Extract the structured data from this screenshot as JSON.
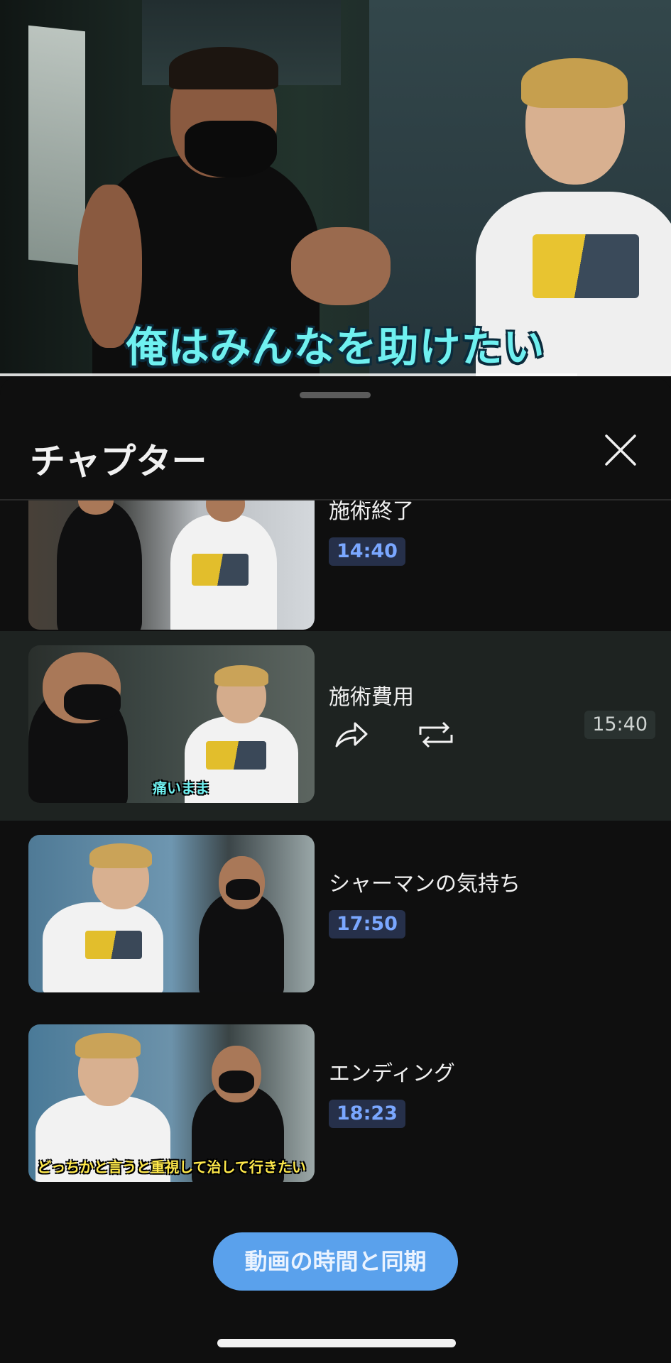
{
  "video": {
    "subtitle": "俺はみんなを助けたい",
    "progress": 0.86
  },
  "sheet": {
    "title": "チャプター",
    "close_icon": "close-icon"
  },
  "chapters": [
    {
      "title": "施術終了",
      "time": "14:40",
      "active": false,
      "thumb_caption": ""
    },
    {
      "title": "施術費用",
      "time": "15:40",
      "active": true,
      "thumb_caption": "痛いまま",
      "actions": [
        "share-icon",
        "repeat-icon"
      ]
    },
    {
      "title": "シャーマンの気持ち",
      "time": "17:50",
      "active": false,
      "thumb_caption": ""
    },
    {
      "title": "エンディング",
      "time": "18:23",
      "active": false,
      "thumb_caption": "どっちかと言うと重視して治して行きたい"
    }
  ],
  "sync_button": {
    "label": "動画の時間と同期"
  },
  "colors": {
    "accent": "#5aa1ec",
    "time_badge_text": "#7aa7ff",
    "active_row": "#1e2321"
  }
}
